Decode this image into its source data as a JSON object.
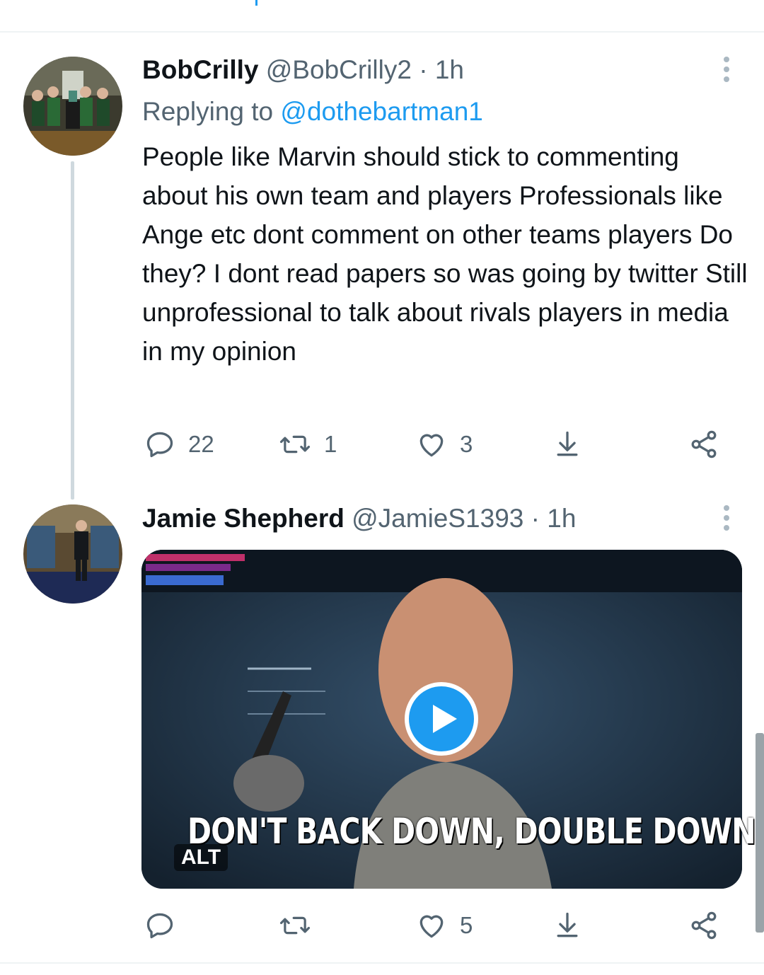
{
  "tweets": [
    {
      "name": "BobCrilly",
      "handle": "@BobCrilly2",
      "separator": "·",
      "time": "1h",
      "replying_prefix": "Replying to",
      "replying_to": "@dothebartman1",
      "text": "People like Marvin should stick to commenting about his own team and players Professionals like Ange etc dont comment on other teams players Do they? I dont read papers so was going by twitter Still unprofessional to talk about rivals players in media in my opinion",
      "replies": "22",
      "retweets": "1",
      "likes": "3"
    },
    {
      "name": "Jamie Shepherd",
      "handle": "@JamieS1393",
      "separator": "·",
      "time": "1h",
      "media": {
        "caption": "DON'T BACK DOWN, DOUBLE DOWN",
        "alt_badge": "ALT",
        "has_play_button": true
      },
      "replies": "",
      "retweets": "",
      "likes": "5"
    }
  ],
  "colors": {
    "accent": "#1d9bf0",
    "secondary_text": "#536471",
    "divider": "#eff3f4"
  },
  "icons": [
    "reply-icon",
    "retweet-icon",
    "like-icon",
    "share-icon",
    "share-network-icon",
    "more-icon",
    "play-icon"
  ]
}
